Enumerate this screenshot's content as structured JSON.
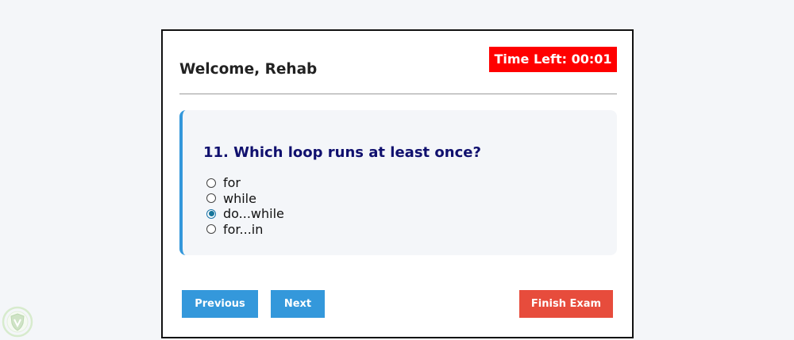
{
  "header": {
    "welcome": "Welcome, Rehab",
    "timer": "Time Left: 00:01"
  },
  "question": {
    "title": "11. Which loop runs at least once?",
    "options": [
      {
        "label": "for",
        "selected": false
      },
      {
        "label": "while",
        "selected": false
      },
      {
        "label": "do...while",
        "selected": true
      },
      {
        "label": "for...in",
        "selected": false
      }
    ]
  },
  "navigation": {
    "previous_label": "Previous",
    "next_label": "Next",
    "finish_label": "Finish Exam"
  },
  "colors": {
    "accent": "#3498db",
    "danger": "#e74c3c",
    "timer_bg": "#ff0000",
    "question_text": "#10106e"
  },
  "icons": {
    "watermark": "shield-logo-icon"
  }
}
